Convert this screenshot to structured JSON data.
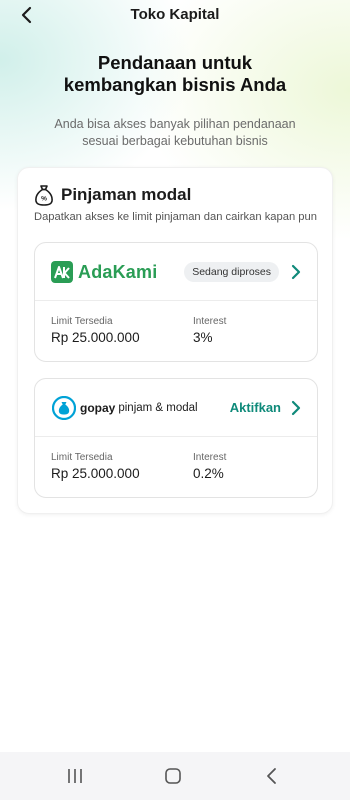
{
  "header": {
    "title": "Toko Kapital"
  },
  "hero": {
    "title": "Pendanaan untuk kembangkan bisnis Anda",
    "subtitle": "Anda bisa akses banyak pilihan pendanaan sesuai berbagai kebutuhan bisnis"
  },
  "section": {
    "title": "Pinjaman modal",
    "subtitle": "Dapatkan akses ke limit pinjaman dan cairkan kapan pun",
    "icon": "money-bag-icon"
  },
  "lenders": [
    {
      "name": "AdaKami",
      "logo_mark": "AK",
      "status": "Sedang diproses",
      "limit_label": "Limit Tersedia",
      "limit_value": "Rp 25.000.000",
      "interest_label": "Interest",
      "interest_value": "3%"
    },
    {
      "name": "gopay",
      "name_suffix": "pinjam & modal",
      "action": "Aktifkan",
      "limit_label": "Limit Tersedia",
      "limit_value": "Rp 25.000.000",
      "interest_label": "Interest",
      "interest_value": "0.2%"
    }
  ],
  "colors": {
    "adakami_green": "#2a9d55",
    "gopay_teal": "#0f8a7a",
    "gopay_blue": "#00a2d6"
  }
}
